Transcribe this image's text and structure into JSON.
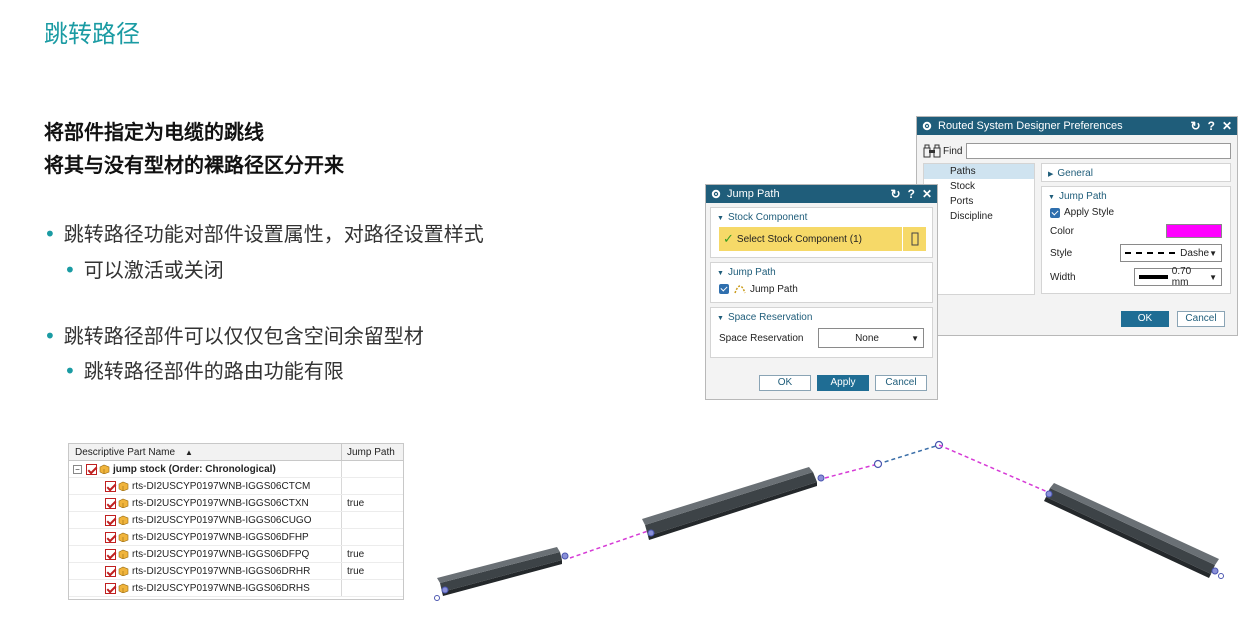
{
  "slide": {
    "title": "跳转路径",
    "subtitle_1": "将部件指定为电缆的跳线",
    "subtitle_2": "将其与没有型材的裸路径区分开来",
    "bullets": [
      "跳转路径功能对部件设置属性，对路径设置样式",
      "可以激活或关闭",
      "跳转路径部件可以仅仅包含空间余留型材",
      "跳转路径部件的路由功能有限"
    ]
  },
  "jump_dialog": {
    "title": "Jump Path",
    "header_buttons": [
      "↻",
      "?",
      "✕"
    ],
    "stock_group": "Stock Component",
    "select_label": "Select Stock Component (1)",
    "jump_group": "Jump Path",
    "jump_check_label": "Jump Path",
    "space_group": "Space Reservation",
    "space_label": "Space Reservation",
    "space_value": "None",
    "ok": "OK",
    "apply": "Apply",
    "cancel": "Cancel"
  },
  "prefs_dialog": {
    "title": "Routed System Designer Preferences",
    "header_buttons": [
      "↻",
      "?",
      "✕"
    ],
    "find_label": "Find",
    "nav": [
      "Paths",
      "Stock",
      "Ports",
      "Discipline"
    ],
    "general_group": "General",
    "jump_group": "Jump Path",
    "apply_style_label": "Apply Style",
    "color_label": "Color",
    "color_value": "#ff00ff",
    "style_label": "Style",
    "style_value": "Dashe",
    "width_label": "Width",
    "width_value": "0.70 mm",
    "ok": "OK",
    "cancel": "Cancel"
  },
  "tree": {
    "col_name": "Descriptive Part Name",
    "col_jump": "Jump Path",
    "root": "jump stock (Order: Chronological)",
    "rows": [
      {
        "name": "rts-DI2USCYP0197WNB-IGGS06CTCM",
        "jump": ""
      },
      {
        "name": "rts-DI2USCYP0197WNB-IGGS06CTXN",
        "jump": "true"
      },
      {
        "name": "rts-DI2USCYP0197WNB-IGGS06CUGO",
        "jump": ""
      },
      {
        "name": "rts-DI2USCYP0197WNB-IGGS06DFHP",
        "jump": ""
      },
      {
        "name": "rts-DI2USCYP0197WNB-IGGS06DFPQ",
        "jump": "true"
      },
      {
        "name": "rts-DI2USCYP0197WNB-IGGS06DRHR",
        "jump": "true"
      },
      {
        "name": "rts-DI2USCYP0197WNB-IGGS06DRHS",
        "jump": ""
      }
    ]
  },
  "colors": {
    "accent": "#1a9ba3",
    "dialog_header": "#1f5d7a",
    "jump_line": "#d63ad6",
    "highlight": "#f6d968"
  }
}
